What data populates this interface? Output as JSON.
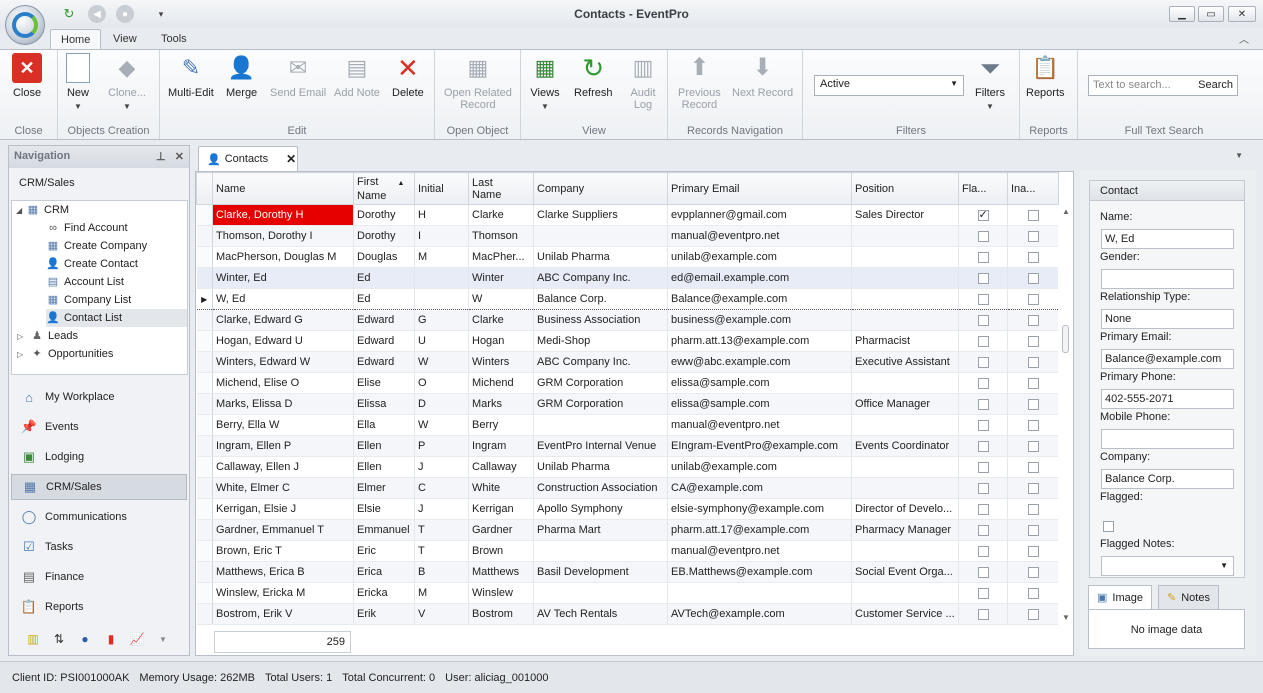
{
  "window": {
    "title": "Contacts - EventPro"
  },
  "ribbon_tabs": [
    {
      "label": "Home"
    },
    {
      "label": "View"
    },
    {
      "label": "Tools"
    }
  ],
  "ribbon": {
    "groups": {
      "close": "Close",
      "objects_creation": "Objects Creation",
      "edit": "Edit",
      "open_object": "Open Object",
      "view": "View",
      "records_navigation": "Records Navigation",
      "filters": "Filters",
      "reports": "Reports",
      "full_text_search": "Full Text Search"
    },
    "buttons": {
      "close": "Close",
      "new": "New",
      "clone": "Clone...",
      "multi_edit": "Multi-Edit",
      "merge": "Merge",
      "send_email": "Send Email",
      "add_note": "Add Note",
      "delete": "Delete",
      "open_related_1": "Open Related",
      "open_related_2": "Record",
      "views": "Views",
      "refresh": "Refresh",
      "audit_1": "Audit",
      "audit_2": "Log",
      "prev_1": "Previous",
      "prev_2": "Record",
      "next_record": "Next Record",
      "filters": "Filters",
      "reports": "Reports"
    },
    "filter_value": "Active",
    "search_placeholder": "Text to search...",
    "search_button": "Search"
  },
  "navigation": {
    "title": "Navigation",
    "section": "CRM/Sales",
    "tree": {
      "crm": "CRM",
      "find_account": "Find Account",
      "create_company": "Create Company",
      "create_contact": "Create Contact",
      "account_list": "Account List",
      "company_list": "Company List",
      "contact_list": "Contact List",
      "leads": "Leads",
      "opportunities": "Opportunities"
    },
    "items": [
      {
        "label": "My Workplace"
      },
      {
        "label": "Events"
      },
      {
        "label": "Lodging"
      },
      {
        "label": "CRM/Sales"
      },
      {
        "label": "Communications"
      },
      {
        "label": "Tasks"
      },
      {
        "label": "Finance"
      },
      {
        "label": "Reports"
      }
    ]
  },
  "document_tab": {
    "label": "Contacts"
  },
  "grid": {
    "columns": {
      "name": "Name",
      "first_name_1": "First",
      "first_name_2": "Name",
      "initial": "Initial",
      "last_name_1": "Last",
      "last_name_2": "Name",
      "company": "Company",
      "primary_email": "Primary Email",
      "position": "Position",
      "flagged": "Fla...",
      "inactive": "Ina..."
    },
    "rows": [
      {
        "name": "Clarke, Dorothy H",
        "first": "Dorothy",
        "initial": "H",
        "last": "Clarke",
        "company": "Clarke Suppliers",
        "email": "evpplanner@gmail.com",
        "position": "Sales Director",
        "flagged": true,
        "inactive": false
      },
      {
        "name": "Thomson, Dorothy I",
        "first": "Dorothy",
        "initial": "I",
        "last": "Thomson",
        "company": "",
        "email": "manual@eventpro.net",
        "position": "",
        "flagged": false,
        "inactive": false
      },
      {
        "name": "MacPherson, Douglas M",
        "first": "Douglas",
        "initial": "M",
        "last": "MacPher...",
        "company": "Unilab Pharma",
        "email": "unilab@example.com",
        "position": "",
        "flagged": false,
        "inactive": false
      },
      {
        "name": "Winter, Ed",
        "first": "Ed",
        "initial": "",
        "last": "Winter",
        "company": "ABC Company Inc.",
        "email": "ed@email.example.com",
        "position": "",
        "flagged": false,
        "inactive": false
      },
      {
        "name": "W, Ed",
        "first": "Ed",
        "initial": "",
        "last": "W",
        "company": "Balance Corp.",
        "email": "Balance@example.com",
        "position": "",
        "flagged": false,
        "inactive": false
      },
      {
        "name": "Clarke, Edward G",
        "first": "Edward",
        "initial": "G",
        "last": "Clarke",
        "company": "Business Association",
        "email": "business@example.com",
        "position": "",
        "flagged": false,
        "inactive": false
      },
      {
        "name": "Hogan, Edward U",
        "first": "Edward",
        "initial": "U",
        "last": "Hogan",
        "company": "Medi-Shop",
        "email": "pharm.att.13@example.com",
        "position": "Pharmacist",
        "flagged": false,
        "inactive": false
      },
      {
        "name": "Winters, Edward W",
        "first": "Edward",
        "initial": "W",
        "last": "Winters",
        "company": "ABC Company Inc.",
        "email": "eww@abc.example.com",
        "position": "Executive Assistant",
        "flagged": false,
        "inactive": false
      },
      {
        "name": "Michend, Elise O",
        "first": "Elise",
        "initial": "O",
        "last": "Michend",
        "company": "GRM Corporation",
        "email": "elissa@sample.com",
        "position": "",
        "flagged": false,
        "inactive": false
      },
      {
        "name": "Marks, Elissa D",
        "first": "Elissa",
        "initial": "D",
        "last": "Marks",
        "company": "GRM Corporation",
        "email": "elissa@sample.com",
        "position": "Office Manager",
        "flagged": false,
        "inactive": false
      },
      {
        "name": "Berry, Ella W",
        "first": "Ella",
        "initial": "W",
        "last": "Berry",
        "company": "",
        "email": "manual@eventpro.net",
        "position": "",
        "flagged": false,
        "inactive": false
      },
      {
        "name": "Ingram, Ellen P",
        "first": "Ellen",
        "initial": "P",
        "last": "Ingram",
        "company": "EventPro Internal Venue",
        "email": "EIngram-EventPro@example.com",
        "position": "Events Coordinator",
        "flagged": false,
        "inactive": false
      },
      {
        "name": "Callaway, Ellen J",
        "first": "Ellen",
        "initial": "J",
        "last": "Callaway",
        "company": "Unilab Pharma",
        "email": "unilab@example.com",
        "position": "",
        "flagged": false,
        "inactive": false
      },
      {
        "name": "White, Elmer C",
        "first": "Elmer",
        "initial": "C",
        "last": "White",
        "company": "Construction Association",
        "email": "CA@example.com",
        "position": "",
        "flagged": false,
        "inactive": false
      },
      {
        "name": "Kerrigan, Elsie J",
        "first": "Elsie",
        "initial": "J",
        "last": "Kerrigan",
        "company": "Apollo Symphony",
        "email": "elsie-symphony@example.com",
        "position": "Director of Develo...",
        "flagged": false,
        "inactive": false
      },
      {
        "name": "Gardner, Emmanuel T",
        "first": "Emmanuel",
        "initial": "T",
        "last": "Gardner",
        "company": "Pharma Mart",
        "email": "pharm.att.17@example.com",
        "position": "Pharmacy Manager",
        "flagged": false,
        "inactive": false
      },
      {
        "name": "Brown, Eric T",
        "first": "Eric",
        "initial": "T",
        "last": "Brown",
        "company": "",
        "email": "manual@eventpro.net",
        "position": "",
        "flagged": false,
        "inactive": false
      },
      {
        "name": "Matthews, Erica B",
        "first": "Erica",
        "initial": "B",
        "last": "Matthews",
        "company": "Basil Development",
        "email": "EB.Matthews@example.com",
        "position": "Social Event Orga...",
        "flagged": false,
        "inactive": false
      },
      {
        "name": "Winslew, Ericka M",
        "first": "Ericka",
        "initial": "M",
        "last": "Winslew",
        "company": "",
        "email": "",
        "position": "",
        "flagged": false,
        "inactive": false
      },
      {
        "name": "Bostrom, Erik V",
        "first": "Erik",
        "initial": "V",
        "last": "Bostrom",
        "company": "AV Tech Rentals",
        "email": "AVTech@example.com",
        "position": "Customer Service ...",
        "flagged": false,
        "inactive": false
      }
    ],
    "record_count": "259"
  },
  "contact_panel": {
    "title": "Contact",
    "name_label": "Name:",
    "name": "W, Ed",
    "gender_label": "Gender:",
    "gender": "",
    "relationship_label": "Relationship Type:",
    "relationship": "None",
    "email_label": "Primary Email:",
    "email": "Balance@example.com",
    "phone_label": "Primary Phone:",
    "phone": "402-555-2071",
    "mobile_label": "Mobile Phone:",
    "mobile": "",
    "company_label": "Company:",
    "company": "Balance Corp.",
    "flagged_label": "Flagged:",
    "flagged_notes_label": "Flagged Notes:",
    "image_tab": "Image",
    "notes_tab": "Notes",
    "no_image": "No image data"
  },
  "status": {
    "client_id": "Client ID: PSI001000AK",
    "memory": "Memory Usage: 262MB",
    "total_users": "Total Users: 1",
    "total_concurrent": "Total Concurrent: 0",
    "user": "User: aliciag_001000"
  }
}
